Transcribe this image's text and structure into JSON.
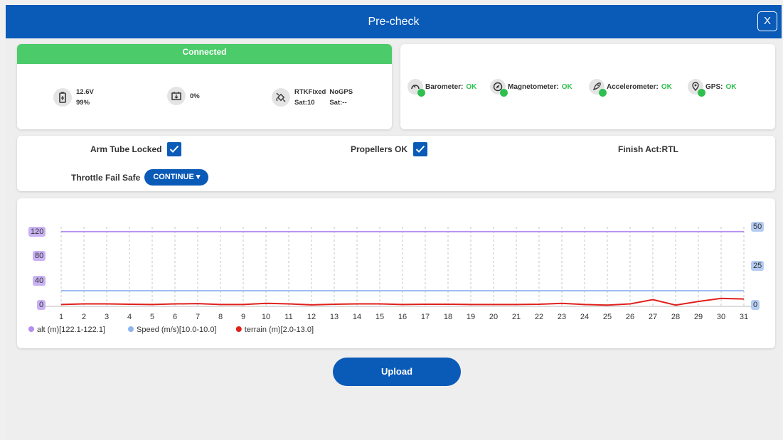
{
  "header": {
    "title": "Pre-check",
    "close_label": "X"
  },
  "connection": {
    "status": "Connected",
    "battery_voltage": "12.6V",
    "battery_percent": "99%",
    "throttle_percent": "0%",
    "gps1_fix": "RTKFixed",
    "gps1_sats": "Sat:10",
    "gps2_fix": "NoGPS",
    "gps2_sats": "Sat:--"
  },
  "sensors": [
    {
      "name": "Barometer:",
      "status": "OK",
      "icon": "barometer-icon"
    },
    {
      "name": "Magnetometer:",
      "status": "OK",
      "icon": "compass-icon"
    },
    {
      "name": "Accelerometer:",
      "status": "OK",
      "icon": "rocket-icon"
    },
    {
      "name": "GPS:",
      "status": "OK",
      "icon": "location-pin-icon"
    }
  ],
  "options": {
    "arm_tube_label": "Arm Tube Locked",
    "arm_tube_checked": true,
    "propellers_label": "Propellers OK",
    "propellers_checked": true,
    "finish_act": "Finish Act:RTL",
    "throttle_failsafe_label": "Throttle Fail Safe",
    "throttle_failsafe_value": "CONTINUE ▾"
  },
  "chart_data": {
    "type": "line",
    "x": [
      1,
      2,
      3,
      4,
      5,
      6,
      7,
      8,
      9,
      10,
      11,
      12,
      13,
      14,
      15,
      16,
      17,
      18,
      19,
      20,
      21,
      22,
      23,
      24,
      25,
      26,
      27,
      28,
      29,
      30,
      31
    ],
    "left_ticks": [
      "0",
      "40",
      "80",
      "120"
    ],
    "right_ticks": [
      "0",
      "25",
      "50"
    ],
    "left_ylim": [
      0,
      130
    ],
    "right_ylim": [
      0,
      50
    ],
    "series": [
      {
        "name": "alt (m)[122.1-122.1]",
        "axis": "left",
        "color": "#b48ef0",
        "values": [
          122.1,
          122.1,
          122.1,
          122.1,
          122.1,
          122.1,
          122.1,
          122.1,
          122.1,
          122.1,
          122.1,
          122.1,
          122.1,
          122.1,
          122.1,
          122.1,
          122.1,
          122.1,
          122.1,
          122.1,
          122.1,
          122.1,
          122.1,
          122.1,
          122.1,
          122.1,
          122.1,
          122.1,
          122.1,
          122.1,
          122.1
        ]
      },
      {
        "name": "Speed (m/s)[10.0-10.0]",
        "axis": "right",
        "color": "#8fb3ee",
        "values": [
          10,
          10,
          10,
          10,
          10,
          10,
          10,
          10,
          10,
          10,
          10,
          10,
          10,
          10,
          10,
          10,
          10,
          10,
          10,
          10,
          10,
          10,
          10,
          10,
          10,
          10,
          10,
          10,
          10,
          10,
          10
        ]
      },
      {
        "name": "terrain (m)[2.0-13.0]",
        "axis": "left",
        "color": "#e0201c",
        "values": [
          3,
          4,
          4,
          3.5,
          3,
          4,
          4.5,
          3,
          3,
          5,
          4,
          2.5,
          3.5,
          4,
          4,
          3,
          3.5,
          3.5,
          3,
          3,
          3,
          3.5,
          5,
          3,
          2,
          4,
          11,
          2,
          8,
          13,
          12
        ]
      }
    ],
    "grid": true,
    "legend_position": "bottom-left"
  },
  "upload_label": "Upload"
}
